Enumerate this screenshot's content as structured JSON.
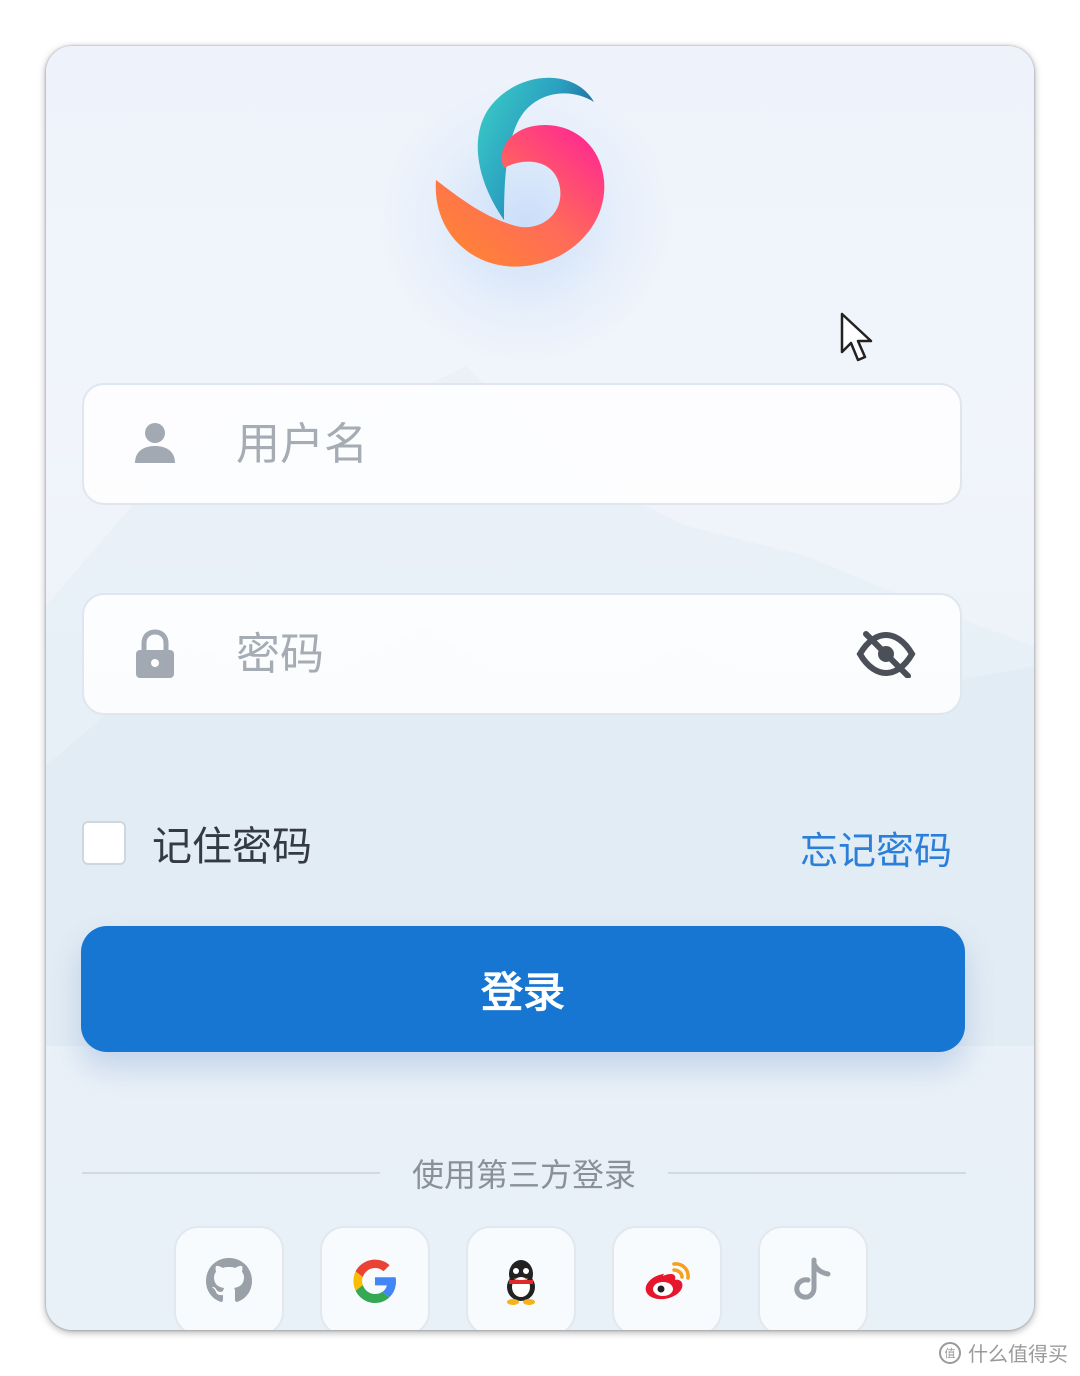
{
  "form": {
    "username": {
      "value": "",
      "placeholder": "用户名"
    },
    "password": {
      "value": "",
      "placeholder": "密码"
    },
    "remember_label": "记住密码",
    "remember_checked": false,
    "forgot_label": "忘记密码",
    "login_label": "登录"
  },
  "third_party": {
    "divider_text": "使用第三方登录",
    "providers": [
      {
        "icon": "github-icon"
      },
      {
        "icon": "google-icon"
      },
      {
        "icon": "qq-icon"
      },
      {
        "icon": "weibo-icon"
      },
      {
        "icon": "douyin-icon"
      }
    ]
  },
  "watermark": {
    "text": "什么值得买"
  },
  "colors": {
    "primary": "#1876d3",
    "link": "#2b7fd8",
    "placeholder": "#a6acb4",
    "icon_gray": "#a3a9b2"
  }
}
